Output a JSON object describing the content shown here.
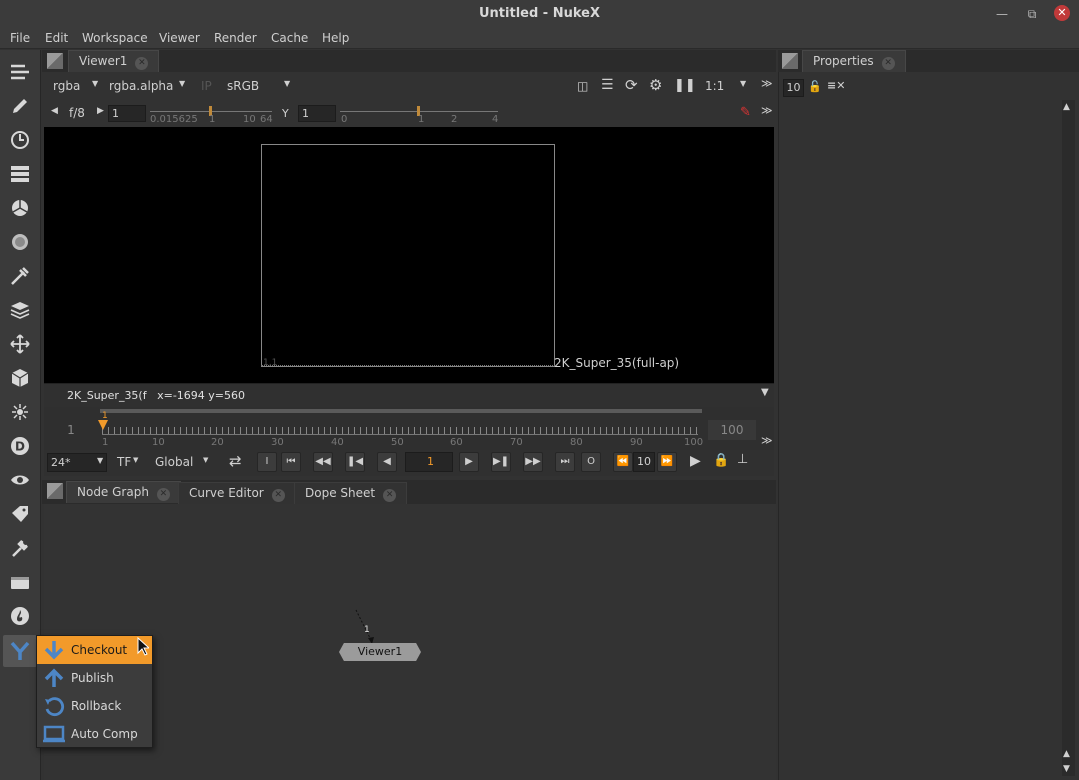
{
  "window": {
    "title": "Untitled - NukeX"
  },
  "menubar": [
    "File",
    "Edit",
    "Workspace",
    "Viewer",
    "Render",
    "Cache",
    "Help"
  ],
  "viewer": {
    "tab_label": "Viewer1",
    "channels": "rgba",
    "alpha_channel": "rgba.alpha",
    "ip_label": "IP",
    "colorspace": "sRGB",
    "zoom": "1:1",
    "fstop": "f/8",
    "gain_value": "1",
    "gain_ticks": [
      "0.015625",
      "1",
      "10",
      "64"
    ],
    "gamma_label": "Y",
    "gamma_value": "1",
    "gamma_ticks": [
      "0",
      "1",
      "2",
      "4"
    ],
    "format_label": "2K_Super_35(full-ap)",
    "corner_label": "1,1",
    "info_text": "2K_Super_35(f   x=-1694 y=560"
  },
  "timeline": {
    "start": "1",
    "end": "100",
    "current": "1",
    "ticks": [
      "1",
      "10",
      "20",
      "30",
      "40",
      "50",
      "60",
      "70",
      "80",
      "90",
      "100"
    ]
  },
  "playback": {
    "fps": "24*",
    "tf": "TF",
    "range_mode": "Global",
    "frame": "1",
    "step": "10",
    "in_label": "I",
    "out_label": "O"
  },
  "nodegraph": {
    "tabs": [
      "Node Graph",
      "Curve Editor",
      "Dope Sheet"
    ],
    "node_name": "Viewer1",
    "input_label": "1"
  },
  "properties": {
    "tab_label": "Properties",
    "max_panels": "10"
  },
  "popup_menu": {
    "items": [
      {
        "label": "Checkout",
        "icon": "arrow-down-icon",
        "selected": true
      },
      {
        "label": "Publish",
        "icon": "arrow-up-icon",
        "selected": false
      },
      {
        "label": "Rollback",
        "icon": "rollback-icon",
        "selected": false
      },
      {
        "label": "Auto Comp",
        "icon": "monitor-icon",
        "selected": false
      }
    ]
  },
  "colors": {
    "accent": "#f29a2a",
    "icon_blue": "#4d86c6",
    "close_red": "#c13a3a"
  }
}
